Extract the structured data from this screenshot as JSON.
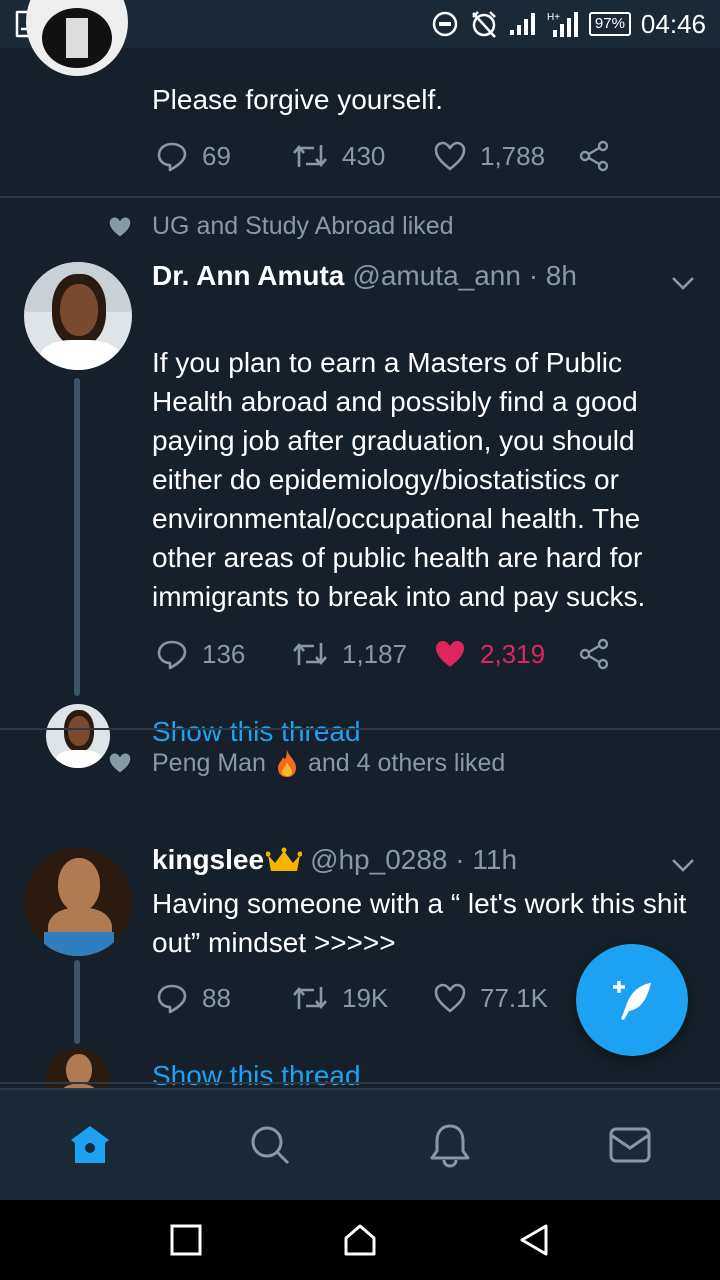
{
  "status_bar": {
    "battery": "97%",
    "time": "04:46"
  },
  "tweets": [
    {
      "text": "Please forgive yourself.",
      "replies": "69",
      "retweets": "430",
      "likes": "1,788"
    },
    {
      "liked_by": "UG and Study Abroad liked",
      "name": "Dr. Ann Amuta",
      "handle": "@amuta_ann · 8h",
      "text": "If you plan to earn a Masters of Public Health abroad and possibly find a good paying job after graduation, you should either do epidemiology/biostatistics or environmental/occupational health. The other areas of public health are hard for immigrants to break into and pay sucks.",
      "replies": "136",
      "retweets": "1,187",
      "likes": "2,319",
      "liked": true,
      "show_thread": "Show this thread"
    },
    {
      "liked_by_name": "Peng Man",
      "liked_by_rest": "and 4 others liked",
      "name": "kingslee",
      "handle": "@hp_0288 · 11h",
      "text": "Having someone with a “ let's work this shit out” mindset >>>>>",
      "replies": "88",
      "retweets": "19K",
      "likes": "77.1K",
      "show_thread": "Show this thread"
    }
  ],
  "nav": {
    "items": [
      "home-icon",
      "search-icon",
      "notifications-icon",
      "messages-icon"
    ],
    "active": "home-icon"
  },
  "colors": {
    "background": "#15202b",
    "accent": "#1da1f2",
    "like": "#e0245e",
    "secondary_text": "#8899a6"
  }
}
